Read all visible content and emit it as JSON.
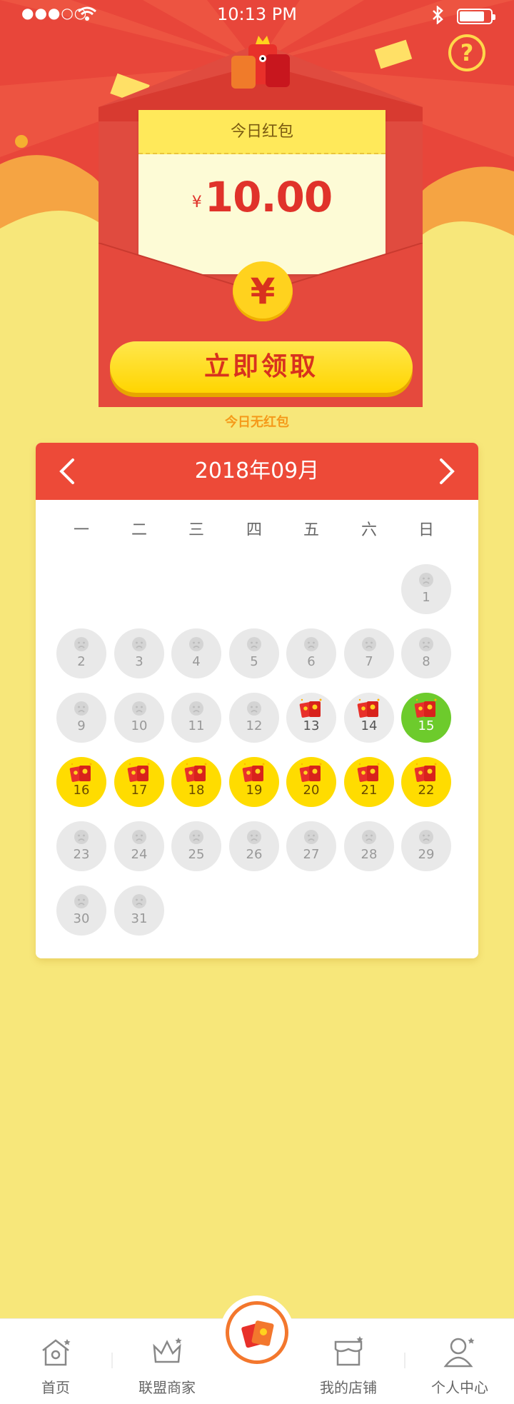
{
  "status_bar": {
    "time": "10:13 PM",
    "signal": "●●●○○"
  },
  "help_icon": "question-icon",
  "packet": {
    "title": "今日红包",
    "currency": "¥",
    "amount": "10.00",
    "coin_symbol": "¥",
    "claim_label": "立即领取",
    "no_packet_text": "今日无红包"
  },
  "calendar": {
    "title": "2018年09月",
    "weekdays": [
      "一",
      "二",
      "三",
      "四",
      "五",
      "六",
      "日"
    ],
    "days": [
      {
        "n": "1",
        "state": "empty"
      },
      {
        "n": "2",
        "state": "empty"
      },
      {
        "n": "3",
        "state": "empty"
      },
      {
        "n": "4",
        "state": "empty"
      },
      {
        "n": "5",
        "state": "empty"
      },
      {
        "n": "6",
        "state": "empty"
      },
      {
        "n": "7",
        "state": "empty"
      },
      {
        "n": "8",
        "state": "empty"
      },
      {
        "n": "9",
        "state": "empty"
      },
      {
        "n": "10",
        "state": "empty"
      },
      {
        "n": "11",
        "state": "empty"
      },
      {
        "n": "12",
        "state": "empty"
      },
      {
        "n": "13",
        "state": "gift"
      },
      {
        "n": "14",
        "state": "gift"
      },
      {
        "n": "15",
        "state": "today"
      },
      {
        "n": "16",
        "state": "claimed"
      },
      {
        "n": "17",
        "state": "claimed"
      },
      {
        "n": "18",
        "state": "claimed"
      },
      {
        "n": "19",
        "state": "claimed"
      },
      {
        "n": "20",
        "state": "claimed"
      },
      {
        "n": "21",
        "state": "claimed"
      },
      {
        "n": "22",
        "state": "claimed"
      },
      {
        "n": "23",
        "state": "empty"
      },
      {
        "n": "24",
        "state": "empty"
      },
      {
        "n": "25",
        "state": "empty"
      },
      {
        "n": "26",
        "state": "empty"
      },
      {
        "n": "27",
        "state": "empty"
      },
      {
        "n": "28",
        "state": "empty"
      },
      {
        "n": "29",
        "state": "empty"
      },
      {
        "n": "30",
        "state": "empty"
      },
      {
        "n": "31",
        "state": "empty"
      }
    ]
  },
  "tabs": [
    {
      "label": "首页",
      "icon": "home-icon"
    },
    {
      "label": "联盟商家",
      "icon": "crown-icon"
    },
    {
      "label": "",
      "icon": "red-packet-icon"
    },
    {
      "label": "我的店铺",
      "icon": "store-icon"
    },
    {
      "label": "个人中心",
      "icon": "user-icon"
    }
  ],
  "colors": {
    "accent": "#ed4a38",
    "gold": "#ffd500",
    "background": "#f7e77a",
    "today": "#6dcb2c"
  }
}
